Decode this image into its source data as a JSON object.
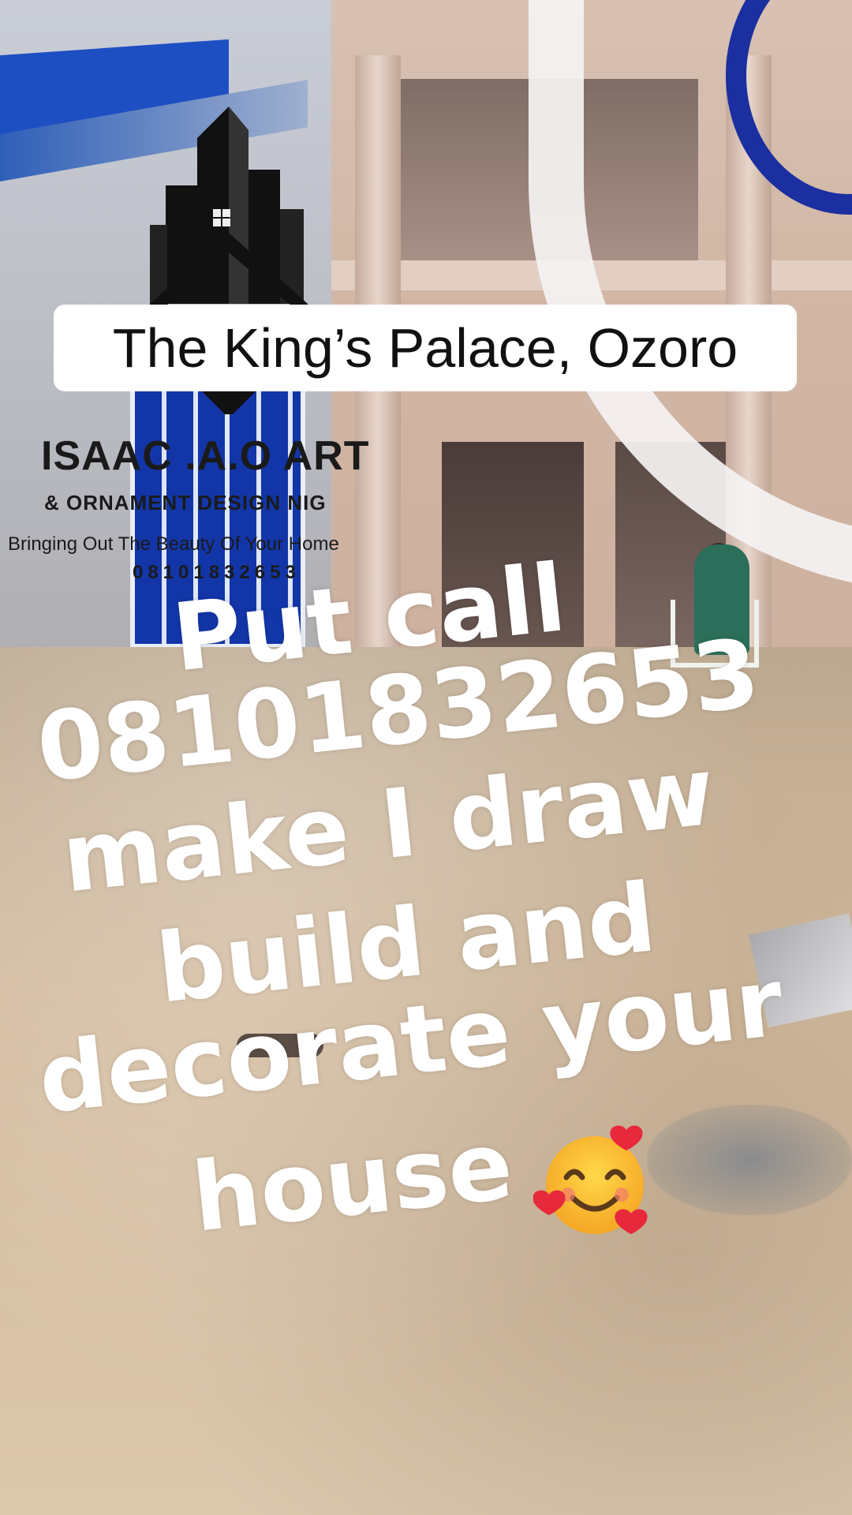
{
  "caption": {
    "title": "The King’s Palace, Ozoro"
  },
  "logo": {
    "name_line": "ISAAC .A.O ART",
    "subtitle_line": "& ORNAMENT DESIGN NIG",
    "tagline": "Bringing Out The Beauty Of Your Home",
    "phone": "08101832653",
    "icon": "building-house-logo-icon"
  },
  "overlay_text": {
    "line1": "Put call",
    "line2": "08101832653",
    "line3": "make I draw",
    "line4": "build and",
    "line5": "decorate your",
    "line6": "house",
    "emoji": "smiling-face-with-hearts-icon"
  },
  "colors": {
    "caption_background": "#ffffff",
    "overlay_text": "#ffffff",
    "roof_blue": "#1e4fc2"
  }
}
